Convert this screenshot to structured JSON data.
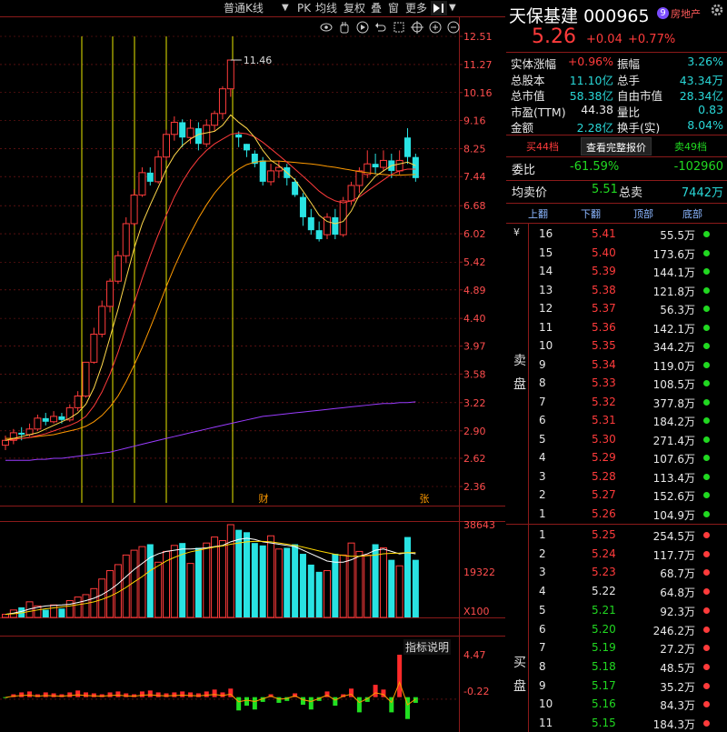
{
  "toolbar": {
    "period": "普通K线",
    "items": [
      "PK",
      "均线",
      "复权",
      "叠",
      "窗",
      "更多"
    ],
    "dropdown_arrow": "▼",
    "icons": [
      "eye-icon",
      "hand-icon",
      "play-icon",
      "undo-icon",
      "zoom-in-icon",
      "zoom-out-icon"
    ]
  },
  "price_axis": [
    "12.51",
    "11.27",
    "10.16",
    "9.16",
    "8.25",
    "7.44",
    "6.68",
    "6.02",
    "5.42",
    "4.89",
    "4.40",
    "3.97",
    "3.58",
    "3.22",
    "2.90",
    "2.62",
    "2.36"
  ],
  "high_marker": "11.46",
  "markers": {
    "cai": "财",
    "zhang": "张"
  },
  "volume_axis": [
    "38643",
    "19322",
    "X100"
  ],
  "indicator": {
    "title": "指标说明",
    "axis": [
      "4.47",
      "-0.22"
    ]
  },
  "stock": {
    "name": "天保基建",
    "code": "000965",
    "badge_num": "9",
    "sector": "房地产",
    "price": "5.26",
    "change": "+0.04",
    "change_pct": "+0.77%"
  },
  "stats": [
    {
      "l1": "实体涨幅",
      "v1": "+0.96%",
      "c1": "red",
      "l2": "振幅",
      "v2": "3.26%",
      "c2": "cyan"
    },
    {
      "l1": "总股本",
      "v1": "11.10亿",
      "c1": "cyan",
      "l2": "总手",
      "v2": "43.34万",
      "c2": "cyan"
    },
    {
      "l1": "总市值",
      "v1": "58.38亿",
      "c1": "cyan",
      "l2": "自由市值",
      "v2": "28.34亿",
      "c2": "cyan"
    },
    {
      "l1": "市盈(TTM)",
      "v1": "44.38",
      "c1": "white",
      "l2": "量比",
      "v2": "0.83",
      "c2": "cyan"
    },
    {
      "l1": "金额",
      "v1": "2.28亿",
      "c1": "cyan",
      "l2": "换手(实)",
      "v2": "8.04%",
      "c2": "cyan"
    }
  ],
  "tabs": {
    "buy": "买44档",
    "full": "查看完整报价",
    "sell": "卖49档"
  },
  "weibi": {
    "label": "委比",
    "pct": "-61.59%",
    "val": "-102960"
  },
  "avg": {
    "label": "均卖价",
    "price": "5.51",
    "label2": "总卖",
    "total": "7442万"
  },
  "book_header": [
    "上翻",
    "下翻",
    "顶部",
    "底部"
  ],
  "currency": "¥",
  "sell_label": [
    "卖",
    "盘"
  ],
  "buy_label": [
    "买",
    "盘"
  ],
  "sells": [
    {
      "n": "16",
      "p": "5.41",
      "v": "55.5万"
    },
    {
      "n": "15",
      "p": "5.40",
      "v": "173.6万"
    },
    {
      "n": "14",
      "p": "5.39",
      "v": "144.1万"
    },
    {
      "n": "13",
      "p": "5.38",
      "v": "121.8万"
    },
    {
      "n": "12",
      "p": "5.37",
      "v": "56.3万"
    },
    {
      "n": "11",
      "p": "5.36",
      "v": "142.1万"
    },
    {
      "n": "10",
      "p": "5.35",
      "v": "344.2万"
    },
    {
      "n": "9",
      "p": "5.34",
      "v": "119.0万"
    },
    {
      "n": "8",
      "p": "5.33",
      "v": "108.5万"
    },
    {
      "n": "7",
      "p": "5.32",
      "v": "377.8万"
    },
    {
      "n": "6",
      "p": "5.31",
      "v": "184.2万"
    },
    {
      "n": "5",
      "p": "5.30",
      "v": "271.4万"
    },
    {
      "n": "4",
      "p": "5.29",
      "v": "107.6万"
    },
    {
      "n": "3",
      "p": "5.28",
      "v": "113.4万"
    },
    {
      "n": "2",
      "p": "5.27",
      "v": "152.6万"
    },
    {
      "n": "1",
      "p": "5.26",
      "v": "104.9万"
    }
  ],
  "buys": [
    {
      "n": "1",
      "p": "5.25",
      "v": "254.5万",
      "c": "red"
    },
    {
      "n": "2",
      "p": "5.24",
      "v": "117.7万",
      "c": "red"
    },
    {
      "n": "3",
      "p": "5.23",
      "v": "68.7万",
      "c": "red"
    },
    {
      "n": "4",
      "p": "5.22",
      "v": "64.8万",
      "c": "white"
    },
    {
      "n": "5",
      "p": "5.21",
      "v": "92.3万",
      "c": "green"
    },
    {
      "n": "6",
      "p": "5.20",
      "v": "246.2万",
      "c": "green"
    },
    {
      "n": "7",
      "p": "5.19",
      "v": "27.2万",
      "c": "green"
    },
    {
      "n": "8",
      "p": "5.18",
      "v": "48.5万",
      "c": "green"
    },
    {
      "n": "9",
      "p": "5.17",
      "v": "35.2万",
      "c": "green"
    },
    {
      "n": "10",
      "p": "5.16",
      "v": "84.3万",
      "c": "green"
    },
    {
      "n": "11",
      "p": "5.15",
      "v": "184.3万",
      "c": "green"
    }
  ],
  "colors": {
    "up": "#ff3b3b",
    "down": "#29e3e3",
    "grid": "#8b1a1a",
    "ma5": "#ffffff",
    "ma10": "#ffd800",
    "ma20": "#ff3b7a",
    "ma60": "#9a3cff",
    "vline": "#e8e800"
  },
  "chart_data": {
    "type": "candlestick",
    "candles": [
      [
        2.75,
        2.8,
        2.7,
        2.85
      ],
      [
        2.8,
        2.88,
        2.76,
        2.92
      ],
      [
        2.88,
        2.86,
        2.8,
        2.94
      ],
      [
        2.86,
        2.92,
        2.84,
        2.98
      ],
      [
        2.92,
        3.04,
        2.9,
        3.08
      ],
      [
        3.04,
        3.0,
        2.96,
        3.1
      ],
      [
        3.0,
        3.06,
        2.98,
        3.12
      ],
      [
        3.06,
        3.02,
        2.98,
        3.1
      ],
      [
        3.02,
        3.16,
        3.0,
        3.2
      ],
      [
        3.16,
        3.3,
        3.12,
        3.36
      ],
      [
        3.3,
        3.74,
        3.28,
        3.74
      ],
      [
        3.74,
        4.15,
        3.72,
        4.25
      ],
      [
        4.15,
        4.6,
        4.1,
        4.7
      ],
      [
        4.6,
        5.05,
        4.5,
        5.1
      ],
      [
        5.05,
        5.55,
        5.0,
        5.65
      ],
      [
        5.55,
        6.25,
        5.4,
        6.4
      ],
      [
        6.25,
        6.95,
        6.2,
        7.1
      ],
      [
        6.95,
        7.55,
        6.9,
        7.7
      ],
      [
        7.55,
        7.3,
        7.2,
        7.7
      ],
      [
        7.3,
        8.0,
        7.25,
        8.2
      ],
      [
        8.0,
        8.7,
        7.9,
        8.85
      ],
      [
        8.7,
        9.1,
        8.5,
        9.3
      ],
      [
        9.1,
        8.6,
        8.3,
        9.2
      ],
      [
        8.6,
        8.9,
        8.4,
        9.2
      ],
      [
        8.9,
        8.4,
        8.2,
        9.1
      ],
      [
        8.4,
        9.0,
        8.3,
        9.2
      ],
      [
        9.0,
        9.4,
        8.8,
        9.5
      ],
      [
        9.4,
        10.3,
        9.2,
        10.4
      ],
      [
        10.3,
        11.46,
        10.0,
        11.46
      ],
      [
        8.7,
        8.6,
        8.3,
        8.8
      ],
      [
        8.4,
        8.2,
        8.0,
        8.4
      ],
      [
        8.1,
        7.8,
        7.7,
        8.2
      ],
      [
        7.9,
        7.3,
        7.2,
        8.0
      ],
      [
        7.3,
        7.6,
        7.2,
        7.8
      ],
      [
        7.6,
        7.7,
        7.4,
        7.9
      ],
      [
        7.7,
        7.4,
        7.2,
        7.8
      ],
      [
        7.3,
        6.95,
        6.9,
        7.4
      ],
      [
        6.9,
        6.4,
        6.2,
        7.0
      ],
      [
        6.4,
        6.1,
        6.0,
        6.6
      ],
      [
        6.1,
        5.9,
        5.85,
        6.3
      ],
      [
        6.0,
        6.4,
        5.9,
        6.5
      ],
      [
        6.4,
        6.0,
        5.9,
        6.6
      ],
      [
        6.0,
        6.8,
        5.95,
        6.9
      ],
      [
        6.8,
        7.2,
        6.7,
        7.3
      ],
      [
        7.2,
        7.6,
        7.0,
        7.7
      ],
      [
        7.5,
        7.8,
        7.4,
        8.2
      ],
      [
        7.8,
        7.7,
        7.5,
        8.1
      ],
      [
        7.7,
        7.9,
        7.6,
        8.2
      ],
      [
        7.9,
        7.6,
        7.4,
        8.1
      ],
      [
        7.6,
        7.9,
        7.5,
        8.2
      ],
      [
        8.6,
        8.0,
        7.8,
        8.9
      ],
      [
        8.0,
        7.4,
        7.3,
        8.1
      ]
    ],
    "ma5": [
      2.8,
      2.82,
      2.84,
      2.86,
      2.88,
      2.92,
      2.96,
      3.0,
      3.04,
      3.1,
      3.2,
      3.4,
      3.7,
      4.1,
      4.55,
      5.1,
      5.7,
      6.25,
      6.7,
      7.15,
      7.65,
      8.05,
      8.35,
      8.55,
      8.7,
      8.75,
      8.8,
      9.0,
      9.35,
      9.1,
      8.9,
      8.6,
      8.2,
      7.9,
      7.75,
      7.55,
      7.35,
      7.05,
      6.75,
      6.45,
      6.3,
      6.25,
      6.3,
      6.55,
      6.95,
      7.2,
      7.45,
      7.6,
      7.75,
      7.8,
      7.85,
      7.75
    ],
    "ma10": [
      2.8,
      2.81,
      2.82,
      2.83,
      2.85,
      2.87,
      2.9,
      2.93,
      2.96,
      3.0,
      3.06,
      3.18,
      3.35,
      3.58,
      3.88,
      4.25,
      4.65,
      5.1,
      5.55,
      6.0,
      6.45,
      6.9,
      7.3,
      7.65,
      7.95,
      8.2,
      8.4,
      8.55,
      8.7,
      8.75,
      8.72,
      8.62,
      8.45,
      8.25,
      8.05,
      7.85,
      7.65,
      7.45,
      7.25,
      7.05,
      6.9,
      6.8,
      6.75,
      6.8,
      6.9,
      7.05,
      7.2,
      7.35,
      7.5,
      7.6,
      7.65,
      7.65
    ],
    "ma20": [
      2.82,
      2.82,
      2.82,
      2.83,
      2.84,
      2.85,
      2.86,
      2.88,
      2.9,
      2.92,
      2.95,
      3.0,
      3.07,
      3.17,
      3.3,
      3.48,
      3.7,
      3.95,
      4.25,
      4.58,
      4.95,
      5.32,
      5.68,
      6.03,
      6.38,
      6.7,
      7.0,
      7.25,
      7.48,
      7.65,
      7.78,
      7.85,
      7.88,
      7.88,
      7.88,
      7.86,
      7.84,
      7.82,
      7.8,
      7.77,
      7.73,
      7.7,
      7.66,
      7.62,
      7.58,
      7.55,
      7.52,
      7.5,
      7.48,
      7.48,
      7.49,
      7.5
    ],
    "ma60": [
      2.6,
      2.6,
      2.6,
      2.6,
      2.61,
      2.61,
      2.62,
      2.62,
      2.63,
      2.64,
      2.65,
      2.66,
      2.67,
      2.68,
      2.7,
      2.72,
      2.74,
      2.76,
      2.78,
      2.8,
      2.82,
      2.84,
      2.86,
      2.88,
      2.9,
      2.92,
      2.94,
      2.96,
      2.98,
      3.0,
      3.02,
      3.04,
      3.06,
      3.07,
      3.08,
      3.09,
      3.1,
      3.11,
      3.12,
      3.13,
      3.14,
      3.15,
      3.16,
      3.17,
      3.18,
      3.19,
      3.2,
      3.21,
      3.21,
      3.22,
      3.22,
      3.23
    ],
    "volume": [
      1300,
      3100,
      4200,
      6500,
      4800,
      3200,
      5200,
      3700,
      7000,
      8500,
      9500,
      12000,
      16000,
      19500,
      22000,
      26000,
      28000,
      29500,
      30500,
      23000,
      27500,
      30000,
      31000,
      22500,
      29000,
      31000,
      33500,
      32000,
      38643,
      36500,
      35500,
      31000,
      30000,
      34000,
      28500,
      29000,
      30500,
      26500,
      22000,
      19000,
      19500,
      26500,
      26000,
      31000,
      27500,
      26000,
      30500,
      29000,
      24000,
      21500,
      33500,
      24000
    ],
    "vol_ma5": [
      1300,
      1800,
      2500,
      3500,
      4200,
      4800,
      5000,
      5200,
      5500,
      6200,
      7000,
      8000,
      9500,
      11500,
      14000,
      17000,
      20000,
      22500,
      25000,
      26500,
      27500,
      28000,
      28500,
      28500,
      28700,
      29000,
      29500,
      30000,
      31500,
      32500,
      33000,
      32500,
      31500,
      31000,
      30500,
      30000,
      29500,
      28000,
      26500,
      25000,
      23500,
      23000,
      23000,
      24000,
      25500,
      26500,
      28000,
      28500,
      27500,
      26500,
      27000,
      26500
    ],
    "vol_ma10": [
      1300,
      1500,
      1900,
      2500,
      3100,
      3600,
      4000,
      4400,
      4800,
      5300,
      5800,
      6500,
      7500,
      8800,
      10500,
      12500,
      14800,
      17000,
      19500,
      21500,
      23500,
      25000,
      26300,
      27300,
      28000,
      28700,
      29300,
      29800,
      30500,
      31000,
      31500,
      31700,
      31700,
      31500,
      31000,
      30500,
      30000,
      29300,
      28500,
      27700,
      27000,
      26300,
      25800,
      25500,
      25500,
      25700,
      26000,
      26500,
      26700,
      26800,
      27000,
      27000
    ],
    "macd": [
      -0.1,
      0.3,
      0.5,
      0.6,
      0.3,
      0.5,
      0.4,
      0.3,
      0.5,
      0.7,
      0.5,
      0.4,
      0.3,
      0.5,
      0.6,
      0.4,
      0.3,
      0.6,
      0.7,
      0.5,
      0.4,
      0.5,
      0.6,
      0.5,
      0.4,
      0.6,
      0.8,
      0.5,
      0.9,
      -1.4,
      -0.9,
      -1.3,
      -0.5,
      0.3,
      -0.6,
      -0.4,
      0.4,
      -0.8,
      -1.3,
      -0.4,
      0.6,
      -0.9,
      0.3,
      0.9,
      -1.6,
      -0.5,
      1.3,
      0.8,
      -1.6,
      4.47,
      -2.3,
      -0.6
    ]
  }
}
